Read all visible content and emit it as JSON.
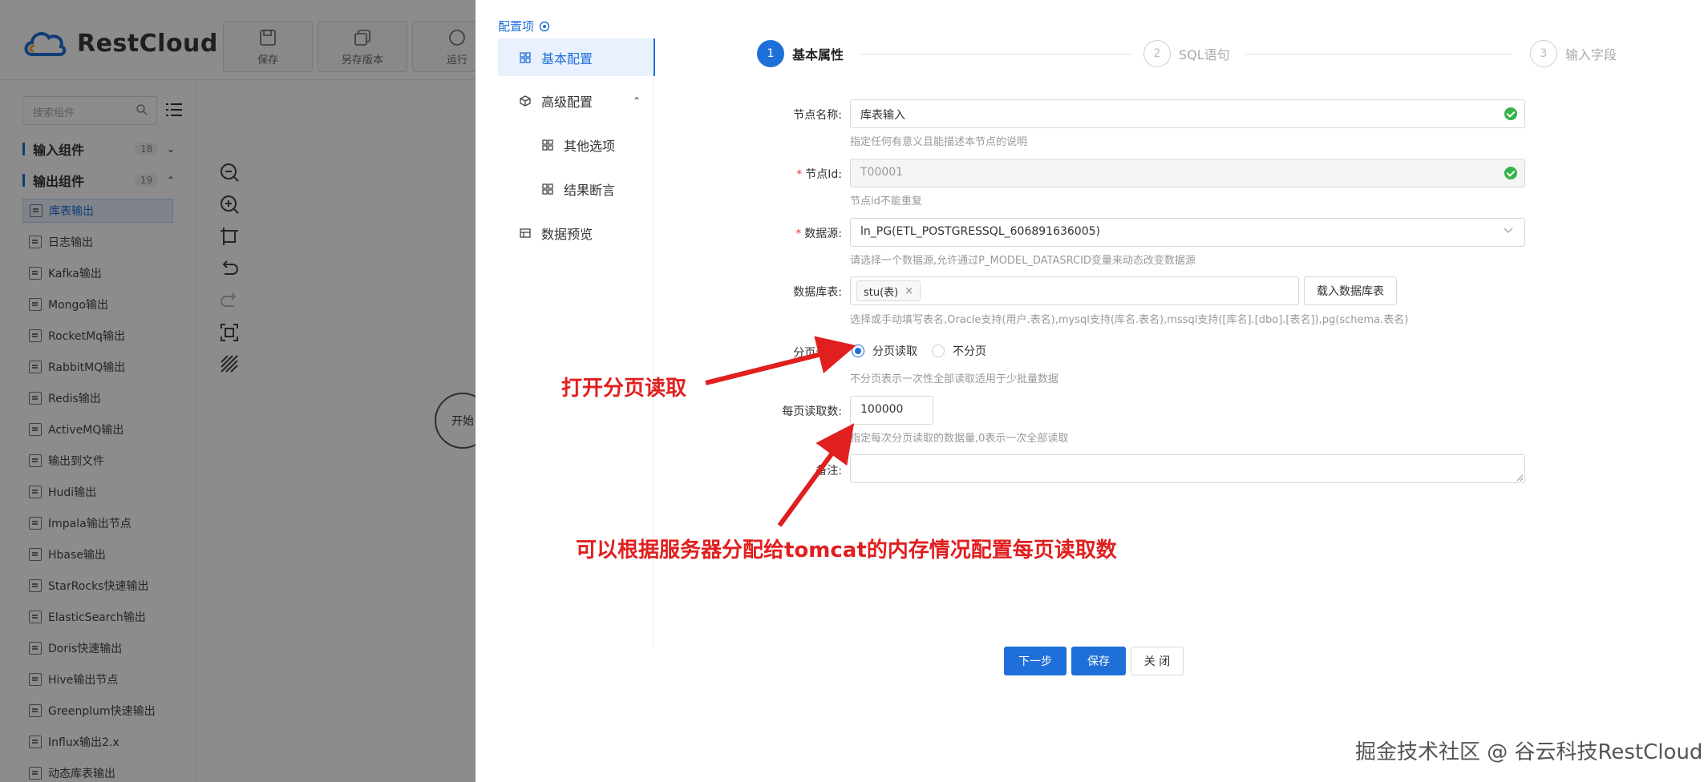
{
  "app": {
    "brand": "RestCloud",
    "toolbar": [
      {
        "label": "保存",
        "icon": "save-icon"
      },
      {
        "label": "另存版本",
        "icon": "copy-icon"
      },
      {
        "label": "运行",
        "icon": "run-icon"
      }
    ]
  },
  "sidebar": {
    "search_placeholder": "搜索组件",
    "groups": [
      {
        "label": "输入组件",
        "count": "18",
        "expanded": false
      },
      {
        "label": "输出组件",
        "count": "19",
        "expanded": true
      }
    ],
    "items": [
      "库表输出",
      "日志输出",
      "Kafka输出",
      "Mongo输出",
      "RocketMq输出",
      "RabbitMQ输出",
      "Redis输出",
      "ActiveMQ输出",
      "输出到文件",
      "Hudi输出",
      "Impala输出节点",
      "Hbase输出",
      "StarRocks快速输出",
      "ElasticSearch输出",
      "Doris快速输出",
      "Hive输出节点",
      "Greenplum快速输出",
      "Influx输出2.x",
      "动态库表输出"
    ],
    "active_item": "库表输出"
  },
  "canvas": {
    "start_node": "开始"
  },
  "drawer": {
    "config_title": "配置项",
    "menu": [
      {
        "label": "基本配置",
        "icon": "grid-icon",
        "active": true
      },
      {
        "label": "高级配置",
        "icon": "cube-icon",
        "active": false
      },
      {
        "label": "其他选项",
        "icon": "grid-icon",
        "active": false
      },
      {
        "label": "结果断言",
        "icon": "grid-icon",
        "active": false
      },
      {
        "label": "数据预览",
        "icon": "table-icon",
        "active": false
      }
    ],
    "steps": [
      {
        "num": "1",
        "label": "基本属性",
        "active": true
      },
      {
        "num": "2",
        "label": "SQL语句",
        "active": false
      },
      {
        "num": "3",
        "label": "输入字段",
        "active": false
      }
    ],
    "form": {
      "node_name": {
        "label": "节点名称:",
        "value": "库表输入",
        "hint": "指定任何有意义且能描述本节点的说明"
      },
      "node_id": {
        "label": "节点Id:",
        "value": "T00001",
        "hint": "节点id不能重复"
      },
      "datasource": {
        "label": "数据源:",
        "value": "ln_PG(ETL_POSTGRESSQL_606891636005)",
        "hint": "请选择一个数据源,允许通过P_MODEL_DATASRCID变量来动态改变数据源"
      },
      "db_table": {
        "label": "数据库表:",
        "tag": "stu(表)",
        "tag_close": "×",
        "load_button": "载入数据库表",
        "hint": "选择或手动填写表名,Oracle支持(用户.表名),mysql支持(库名.表名),mssql支持([库名].[dbo].[表名]),pg(schema.表名)"
      },
      "paging": {
        "label": "分页读取:",
        "option_on": "分页读取",
        "option_off": "不分页",
        "selected": "分页读取",
        "hint": "不分页表示一次性全部读取适用于少批量数据"
      },
      "page_size": {
        "label": "每页读取数:",
        "value": "100000",
        "hint": "指定每次分页读取的数据量,0表示一次全部读取"
      },
      "remark": {
        "label": "备注:",
        "value": ""
      }
    },
    "buttons": {
      "next": "下一步",
      "save": "保存",
      "close": "关 闭"
    }
  },
  "annotations": {
    "a1": "打开分页读取",
    "a2": "可以根据服务器分配给tomcat的内存情况配置每页读取数"
  },
  "watermark": "掘金技术社区 @ 谷云科技RestCloud",
  "colors": {
    "accent": "#1f6fd8",
    "annotation": "#e01f1f",
    "success": "#35b34a"
  }
}
